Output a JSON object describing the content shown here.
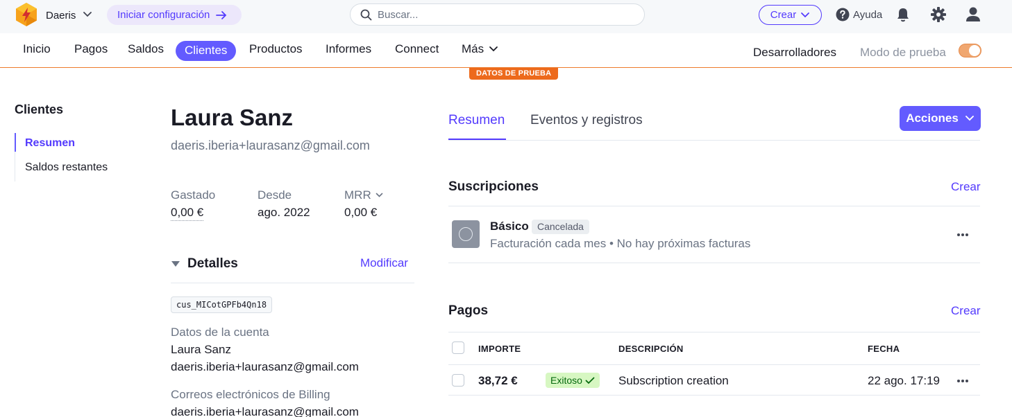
{
  "topbar": {
    "account_name": "Daeris",
    "setup_label": "Iniciar configuración",
    "search_placeholder": "Buscar...",
    "create_label": "Crear",
    "help_label": "Ayuda"
  },
  "nav": {
    "items": [
      "Inicio",
      "Pagos",
      "Saldos",
      "Clientes",
      "Productos",
      "Informes",
      "Connect",
      "Más"
    ],
    "active": "Clientes",
    "developers": "Desarrolladores",
    "test_mode": "Modo de prueba",
    "test_mode_on": true,
    "test_badge": "DATOS DE PRUEBA"
  },
  "sidebar": {
    "title": "Clientes",
    "items": [
      "Resumen",
      "Saldos restantes"
    ]
  },
  "customer": {
    "name": "Laura Sanz",
    "email": "daeris.iberia+laurasanz@gmail.com",
    "stats": [
      {
        "label": "Gastado",
        "value": "0,00 €"
      },
      {
        "label": "Desde",
        "value": "ago. 2022"
      },
      {
        "label": "MRR",
        "value": "0,00 €"
      }
    ],
    "details_title": "Detalles",
    "modify_label": "Modificar",
    "id": "cus_MICotGPFb4Qn18",
    "account_label": "Datos de la cuenta",
    "account_name": "Laura Sanz",
    "account_email": "daeris.iberia+laurasanz@gmail.com",
    "billing_label": "Correos electrónicos de Billing",
    "billing_email": "daeris.iberia+laurasanz@gmail.com"
  },
  "main": {
    "tabs": [
      "Resumen",
      "Eventos y registros"
    ],
    "actions_label": "Acciones",
    "subscriptions": {
      "title": "Suscripciones",
      "create_label": "Crear",
      "item": {
        "name": "Básico",
        "status": "Cancelada",
        "description": "Facturación cada mes • No hay próximas facturas"
      }
    },
    "payments": {
      "title": "Pagos",
      "create_label": "Crear",
      "columns": [
        "IMPORTE",
        "DESCRIPCIÓN",
        "FECHA"
      ],
      "rows": [
        {
          "amount": "38,72 €",
          "status": "Exitoso",
          "description": "Subscription creation",
          "date": "22 ago. 17:19"
        }
      ]
    }
  },
  "colors": {
    "accent": "#635bff",
    "link": "#533afd",
    "test_orange": "#ed6a1c",
    "success_bg": "#d7f7c2"
  }
}
